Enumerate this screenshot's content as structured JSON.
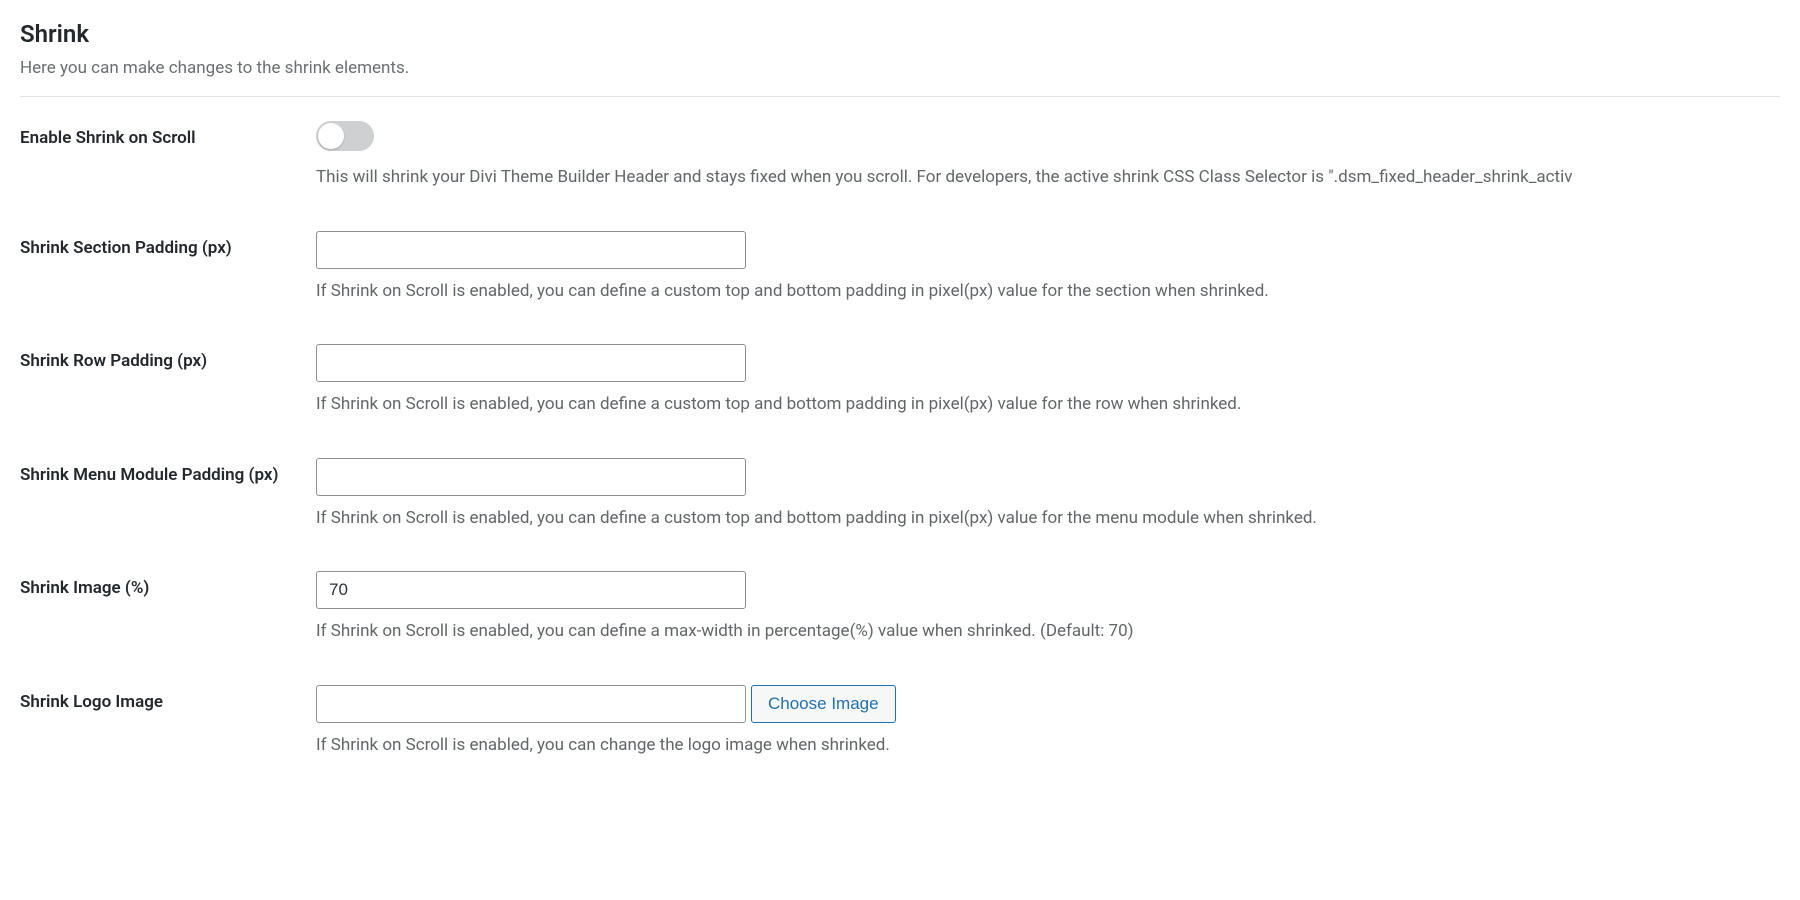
{
  "section": {
    "title": "Shrink",
    "description": "Here you can make changes to the shrink elements."
  },
  "fields": {
    "enable_shrink": {
      "label": "Enable Shrink on Scroll",
      "help": "This will shrink your Divi Theme Builder Header and stays fixed when you scroll. For developers, the active shrink CSS Class Selector is \".dsm_fixed_header_shrink_activ",
      "value": false
    },
    "section_padding": {
      "label": "Shrink Section Padding (px)",
      "help": "If Shrink on Scroll is enabled, you can define a custom top and bottom padding in pixel(px) value for the section when shrinked.",
      "value": ""
    },
    "row_padding": {
      "label": "Shrink Row Padding (px)",
      "help": "If Shrink on Scroll is enabled, you can define a custom top and bottom padding in pixel(px) value for the row when shrinked.",
      "value": ""
    },
    "menu_module_padding": {
      "label": "Shrink Menu Module Padding (px)",
      "help": "If Shrink on Scroll is enabled, you can define a custom top and bottom padding in pixel(px) value for the menu module when shrinked.",
      "value": ""
    },
    "shrink_image": {
      "label": "Shrink Image (%)",
      "help": "If Shrink on Scroll is enabled, you can define a max-width in percentage(%) value when shrinked. (Default: 70)",
      "value": "70"
    },
    "logo_image": {
      "label": "Shrink Logo Image",
      "help": "If Shrink on Scroll is enabled, you can change the logo image when shrinked.",
      "value": "",
      "button": "Choose Image"
    }
  }
}
